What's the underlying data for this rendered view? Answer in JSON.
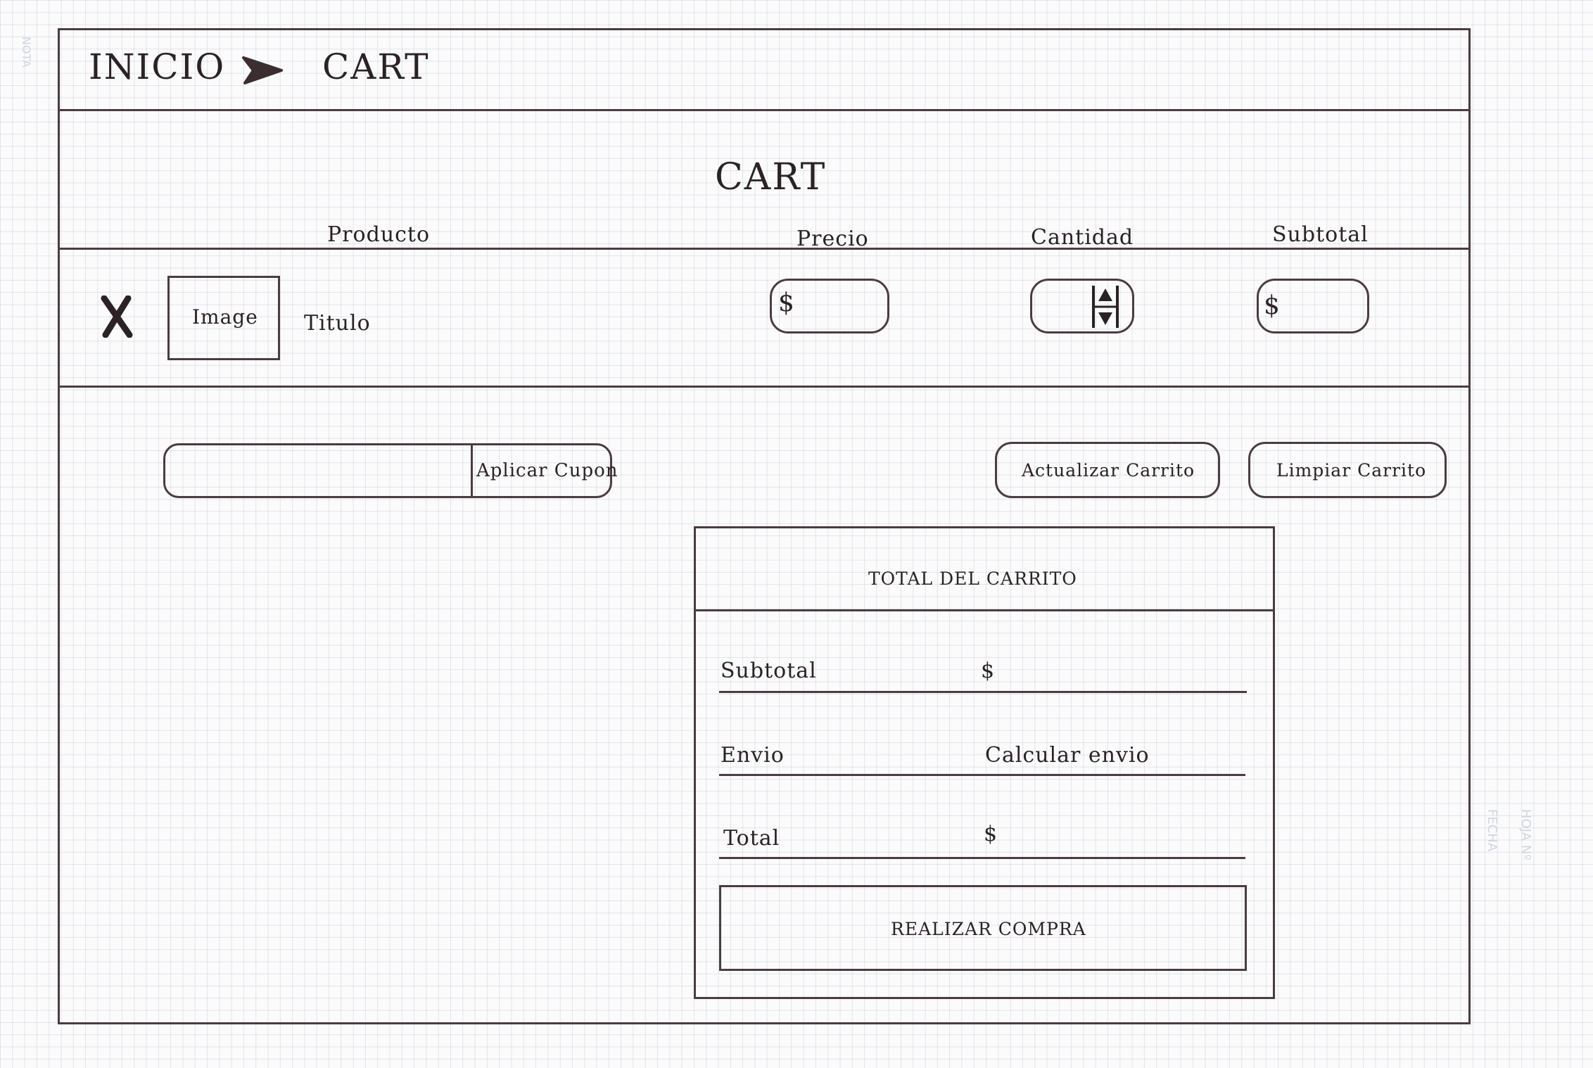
{
  "breadcrumb": {
    "home": "INICIO",
    "current": "CART"
  },
  "page": {
    "title": "CART"
  },
  "table": {
    "headers": {
      "product": "Producto",
      "price": "Precio",
      "quantity": "Cantidad",
      "subtotal": "Subtotal"
    },
    "row": {
      "image_label": "Image",
      "title": "Titulo",
      "price_symbol": "$",
      "subtotal_symbol": "$"
    }
  },
  "actions": {
    "apply_coupon": "Aplicar Cupon",
    "update_cart": "Actualizar Carrito",
    "clear_cart": "Limpiar Carrito"
  },
  "totals": {
    "heading": "TOTAL DEL CARRITO",
    "subtotal_label": "Subtotal",
    "subtotal_value": "$",
    "shipping_label": "Envio",
    "shipping_value": "Calcular envio",
    "total_label": "Total",
    "total_value": "$",
    "checkout": "REALIZAR COMPRA"
  },
  "paper_margin": {
    "nota": "NOTA",
    "fecha": "FECHA",
    "hoja": "HOJA Nº"
  }
}
